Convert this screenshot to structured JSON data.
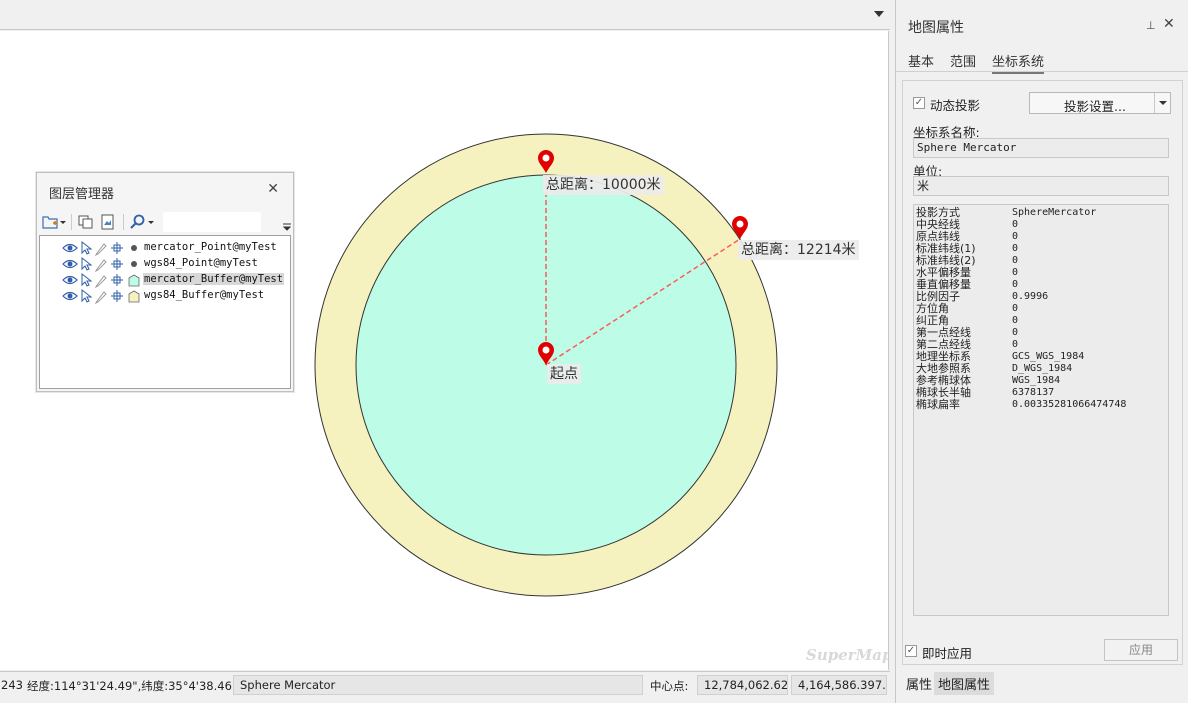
{
  "map": {
    "labels": {
      "point1": "总距离：10000米",
      "point2": "总距离：12214米",
      "origin": "起点"
    },
    "watermark": "SuperMap",
    "colors": {
      "inner_buffer": "#bdfce6",
      "outer_buffer": "#f5f2c0",
      "marker": "#e00000",
      "line": "#ff5a5a"
    }
  },
  "layer_manager": {
    "title": "图层管理器",
    "close_icon": "close-icon",
    "search": {
      "value": "",
      "placeholder": ""
    },
    "layers": [
      {
        "name": "mercator_Point@myTest",
        "type": "point",
        "selected": false
      },
      {
        "name": "wgs84_Point@myTest",
        "type": "point",
        "selected": false
      },
      {
        "name": "mercator_Buffer@myTest",
        "type": "region",
        "selected": true,
        "color": "#bdfce6"
      },
      {
        "name": "wgs84_Buffer@myTest",
        "type": "region",
        "selected": false,
        "color": "#f5f2c0"
      }
    ]
  },
  "statusbar": {
    "scale_fragment": "243",
    "coords": "经度:114°31'24.49\",纬度:35°4'38.46\"",
    "crs": "Sphere Mercator",
    "center_label": "中心点:",
    "center_x": "12,784,062.62...",
    "center_y": "4,164,586.397..."
  },
  "panel": {
    "title": "地图属性",
    "pin_icon": "pin-icon",
    "close_icon": "close-icon",
    "tabs": [
      "基本",
      "范围",
      "坐标系统"
    ],
    "active_tab": "坐标系统",
    "dynamic_projection": {
      "label": "动态投影",
      "checked": true
    },
    "projection_button": "投影设置...",
    "crs_name_label": "坐标系名称:",
    "crs_name_value": "Sphere Mercator",
    "unit_label": "单位:",
    "unit_value": "米",
    "params": [
      {
        "key": "投影方式",
        "value": "SphereMercator"
      },
      {
        "key": "中央经线",
        "value": "0"
      },
      {
        "key": "原点纬线",
        "value": "0"
      },
      {
        "key": "标准纬线(1)",
        "value": "0"
      },
      {
        "key": "标准纬线(2)",
        "value": "0"
      },
      {
        "key": "水平偏移量",
        "value": "0"
      },
      {
        "key": "垂直偏移量",
        "value": "0"
      },
      {
        "key": "比例因子",
        "value": "0.9996"
      },
      {
        "key": "方位角",
        "value": "0"
      },
      {
        "key": "纠正角",
        "value": "0"
      },
      {
        "key": "第一点经线",
        "value": "0"
      },
      {
        "key": "第二点经线",
        "value": "0"
      },
      {
        "key": "地理坐标系",
        "value": "GCS_WGS_1984"
      },
      {
        "key": "大地参照系",
        "value": "D_WGS_1984"
      },
      {
        "key": "参考椭球体",
        "value": "WGS_1984"
      },
      {
        "key": "椭球长半轴",
        "value": "6378137"
      },
      {
        "key": "椭球扁率",
        "value": "0.00335281066474748"
      }
    ],
    "apply_immediately": {
      "label": "即时应用",
      "checked": true
    },
    "apply_button": "应用",
    "bottom_tabs": [
      "属性",
      "地图属性"
    ],
    "active_bottom_tab": "地图属性"
  }
}
